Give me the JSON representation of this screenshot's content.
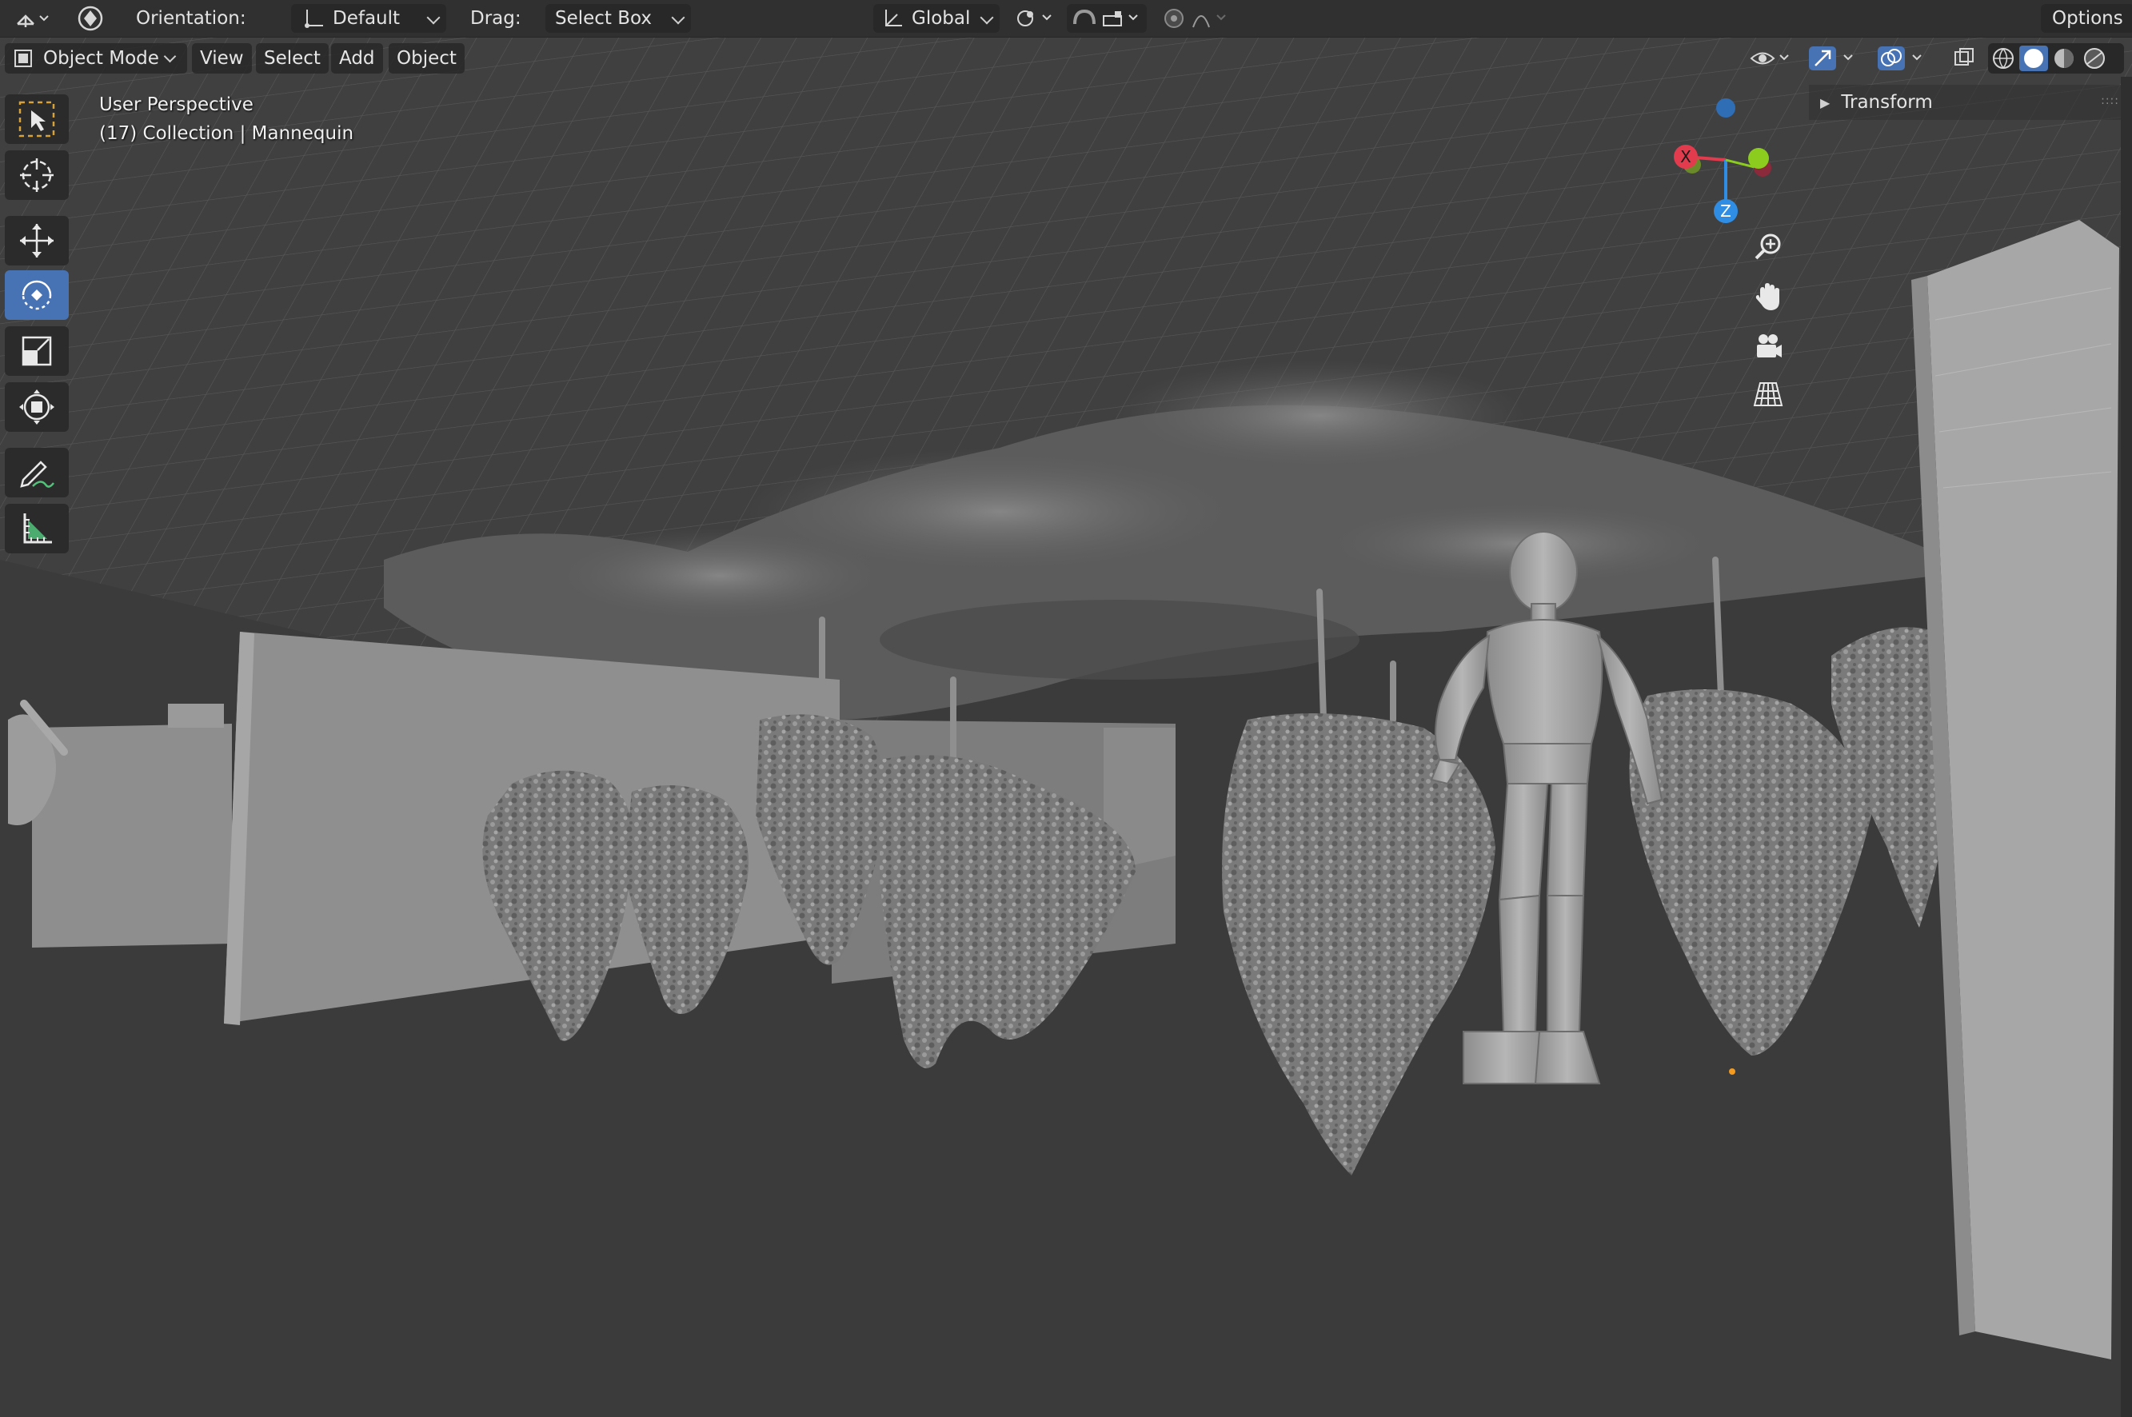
{
  "header": {
    "orientation_label": "Orientation:",
    "orientation_value": "Default",
    "drag_label": "Drag:",
    "drag_value": "Select Box",
    "transform_orientation": "Global",
    "options_label": "Options"
  },
  "menubar": {
    "mode": "Object Mode",
    "items": [
      "View",
      "Select",
      "Add",
      "Object"
    ]
  },
  "viewport": {
    "view_name": "User Perspective",
    "collection_info": "(17) Collection | Mannequin"
  },
  "gizmo": {
    "x_label": "X",
    "z_label": "Z",
    "colors": {
      "x": "#e23b4e",
      "y": "#8ccc1f",
      "z": "#2f8de4"
    }
  },
  "sidebar": {
    "panel_title": "Transform"
  },
  "tools": [
    {
      "name": "select-box-tool",
      "icon": "select-cursor-icon"
    },
    {
      "name": "cursor-tool",
      "icon": "crosshair-icon"
    },
    {
      "name": "move-tool",
      "icon": "move-arrows-icon"
    },
    {
      "name": "rotate-tool",
      "icon": "rotate-icon"
    },
    {
      "name": "scale-tool",
      "icon": "scale-icon"
    },
    {
      "name": "transform-tool",
      "icon": "transform-icon"
    },
    {
      "name": "annotate-tool",
      "icon": "pencil-icon"
    },
    {
      "name": "measure-tool",
      "icon": "ruler-icon"
    }
  ],
  "colors": {
    "accent": "#4772b3",
    "header_bg": "#303030",
    "viewport_bg": "#3a3a3a"
  }
}
